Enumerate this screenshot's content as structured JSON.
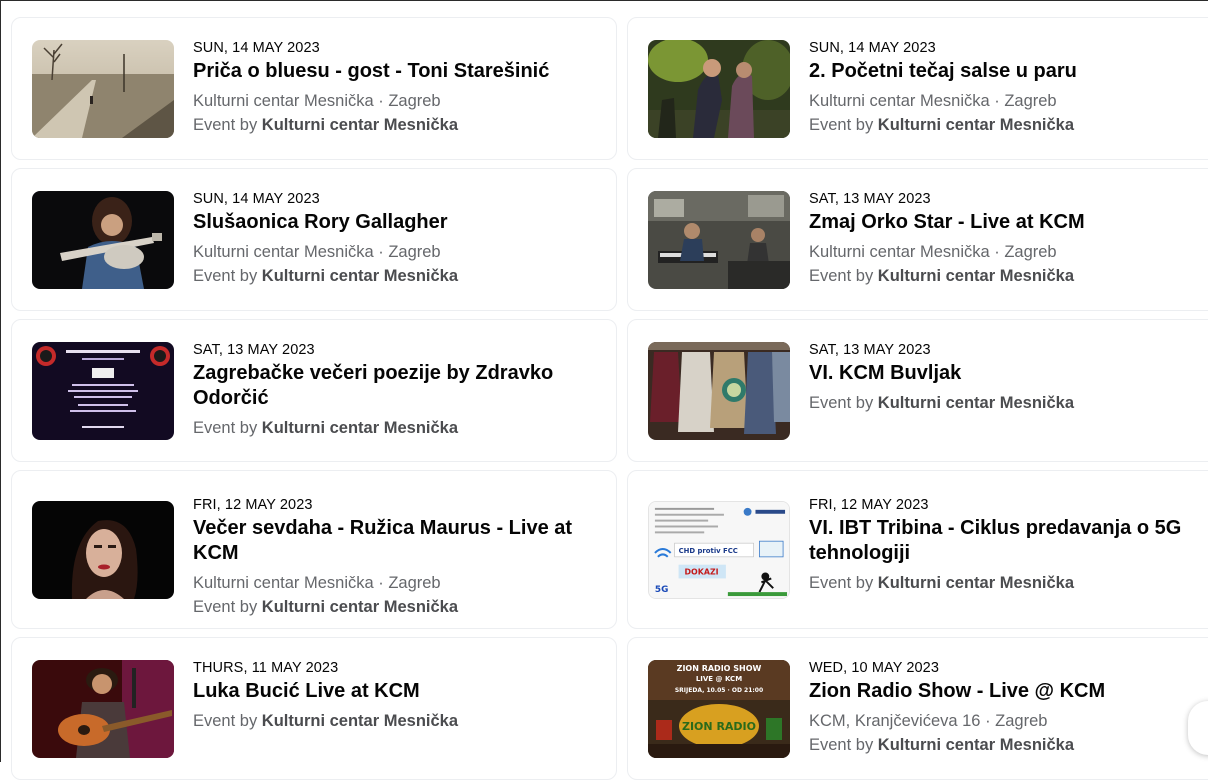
{
  "events": [
    {
      "date": "SUN, 14 MAY 2023",
      "title": "Priča o bluesu - gost - Toni Starešinić",
      "location": "Kulturni centar Mesnička · Zagreb",
      "by_prefix": "Event by ",
      "organizer": "Kulturni centar Mesnička",
      "image": "road-landscape-photo"
    },
    {
      "date": "SUN, 14 MAY 2023",
      "title": "2. Početni tečaj salse u paru",
      "location": "Kulturni centar Mesnička · Zagreb",
      "by_prefix": "Event by ",
      "organizer": "Kulturni centar Mesnička",
      "image": "salsa-dancers-photo"
    },
    {
      "date": "SUN, 14 MAY 2023",
      "title": "Slušaonica Rory Gallagher",
      "location": "Kulturni centar Mesnička · Zagreb",
      "by_prefix": "Event by ",
      "organizer": "Kulturni centar Mesnička",
      "image": "guitarist-photo"
    },
    {
      "date": "SAT, 13 MAY 2023",
      "title": "Zmaj Orko Star - Live at KCM",
      "location": "Kulturni centar Mesnička · Zagreb",
      "by_prefix": "Event by ",
      "organizer": "Kulturni centar Mesnička",
      "image": "studio-band-photo"
    },
    {
      "date": "SAT, 13 MAY 2023",
      "title": "Zagrebačke večeri poezije by Zdravko Odorčić",
      "location": "",
      "by_prefix": "Event by ",
      "organizer": "Kulturni centar Mesnička",
      "image": "poetry-poster"
    },
    {
      "date": "SAT, 13 MAY 2023",
      "title": "VI. KCM Buvljak",
      "location": "",
      "by_prefix": "Event by ",
      "organizer": "Kulturni centar Mesnička",
      "image": "flea-market-clothes-photo"
    },
    {
      "date": "FRI, 12 MAY 2023",
      "title": "Večer sevdaha - Ružica Maurus - Live at KCM",
      "location": "Kulturni centar Mesnička · Zagreb",
      "by_prefix": "Event by ",
      "organizer": "Kulturni centar Mesnička",
      "image": "singer-portrait-photo"
    },
    {
      "date": "FRI, 12 MAY 2023",
      "title": "VI. IBT Tribina - Ciklus predavanja o 5G tehnologiji",
      "location": "",
      "by_prefix": "Event by ",
      "organizer": "Kulturni centar Mesnička",
      "image": "5g-lecture-flyer"
    },
    {
      "date": "THURS, 11 MAY 2023",
      "title": "Luka Bucić Live at KCM",
      "location": "",
      "by_prefix": "Event by ",
      "organizer": "Kulturni centar Mesnička",
      "image": "acoustic-guitarist-photo"
    },
    {
      "date": "WED, 10 MAY 2023",
      "title": "Zion Radio Show - Live @ KCM",
      "location": "KCM, Kranjčevićeva 16 · Zagreb",
      "by_prefix": "Event by ",
      "organizer": "Kulturni centar Mesnička",
      "image": "zion-radio-poster"
    }
  ],
  "poster_text": {
    "flyer_badge": "DOKAZI",
    "flyer_line": "CHD protiv FCC",
    "flyer_5g": "5G",
    "zion_line1": "ZION RADIO SHOW",
    "zion_line2": "LIVE @ KCM",
    "zion_line3": "SRIJEDA, 10.05 · OD 21:00",
    "zion_logo": "ZION RADIO"
  },
  "colors": {
    "text_primary": "#050505",
    "text_secondary": "#65676b",
    "card_border": "#eceef1"
  }
}
